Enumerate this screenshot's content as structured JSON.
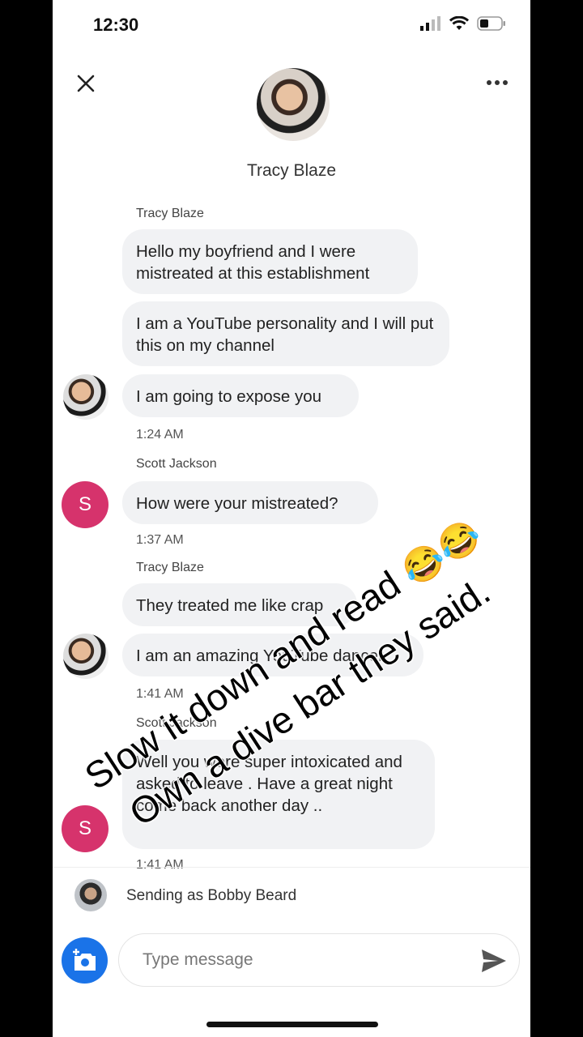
{
  "status_bar": {
    "time": "12:30"
  },
  "header": {
    "name": "Tracy Blaze"
  },
  "messages": [
    {
      "sender": "Tracy Blaze",
      "texts": [
        "Hello my boyfriend and I were mistreated at this establishment",
        "I am a YouTube personality and I will put this on my channel",
        "I am going to expose you"
      ],
      "time": "1:24 AM"
    },
    {
      "sender": "Scott Jackson",
      "texts": [
        "How were your mistreated?"
      ],
      "time": "1:37 AM"
    },
    {
      "sender": "Tracy Blaze",
      "texts": [
        "They treated me like crap",
        "I am an amazing YouTube dancer"
      ],
      "time": "1:41 AM"
    },
    {
      "sender": "Scott Jackson",
      "texts": [
        "Well you were super intoxicated and asked to leave .  Have a great night come back another day .."
      ],
      "time": "1:41 AM"
    }
  ],
  "composer": {
    "sending_as": "Sending as Bobby Beard",
    "placeholder": "Type message"
  },
  "overlay": {
    "line1": "Slow it down and read",
    "line2": "Own a dive bar they said.",
    "emoji": "😂😂"
  },
  "icons": {
    "close": "close-icon",
    "more": "more-icon",
    "camera": "add-photo-icon",
    "send": "send-icon",
    "signal": "signal-icon",
    "wifi": "wifi-icon",
    "battery": "battery-icon"
  },
  "colors": {
    "avatar_s": "#d6336c",
    "camera_button": "#1a73e8",
    "bubble": "#f1f2f4"
  }
}
